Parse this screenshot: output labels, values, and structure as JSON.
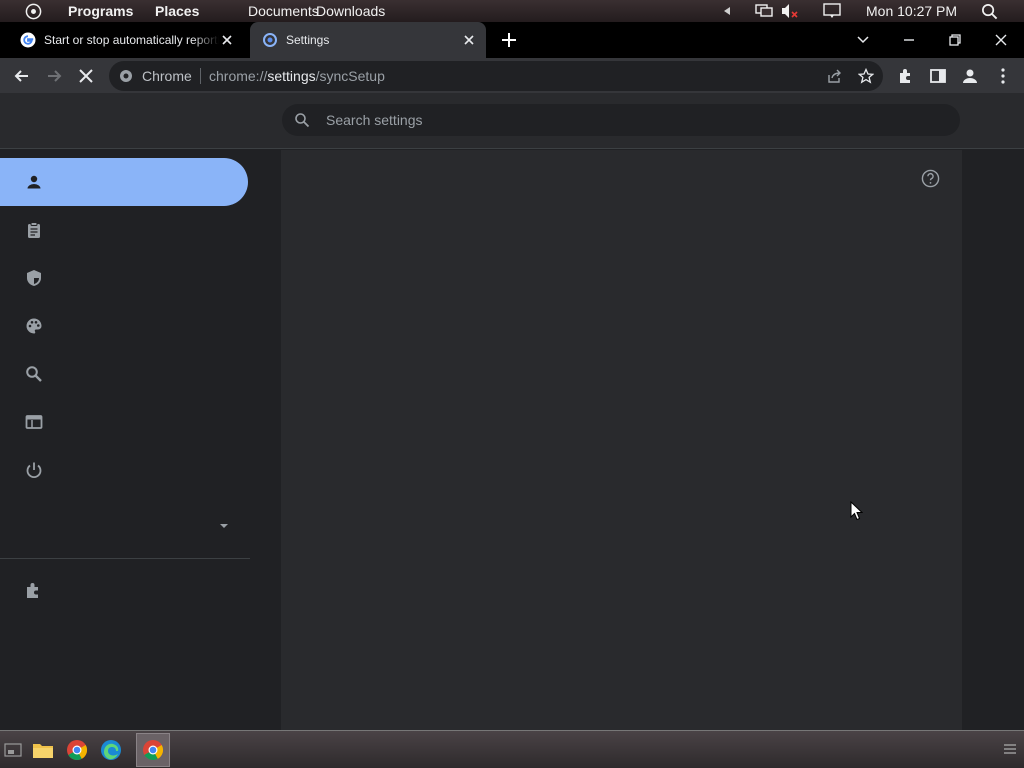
{
  "system_panel": {
    "menus": [
      "Programs",
      "Places",
      "Documents",
      "Downloads"
    ],
    "clock": "Mon 10:27 PM"
  },
  "tabs": [
    {
      "title": "Start or stop automatically reporting"
    },
    {
      "title": "Settings"
    }
  ],
  "toolbar": {
    "site_chip": "Chrome",
    "url_prefix": "chrome://",
    "url_host": "settings",
    "url_path": "/syncSetup"
  },
  "settings": {
    "search_placeholder": "Search settings"
  },
  "colors": {
    "accent": "#8ab4f8",
    "background": "#202124",
    "card": "#292a2d",
    "toolbar": "#35363a"
  }
}
